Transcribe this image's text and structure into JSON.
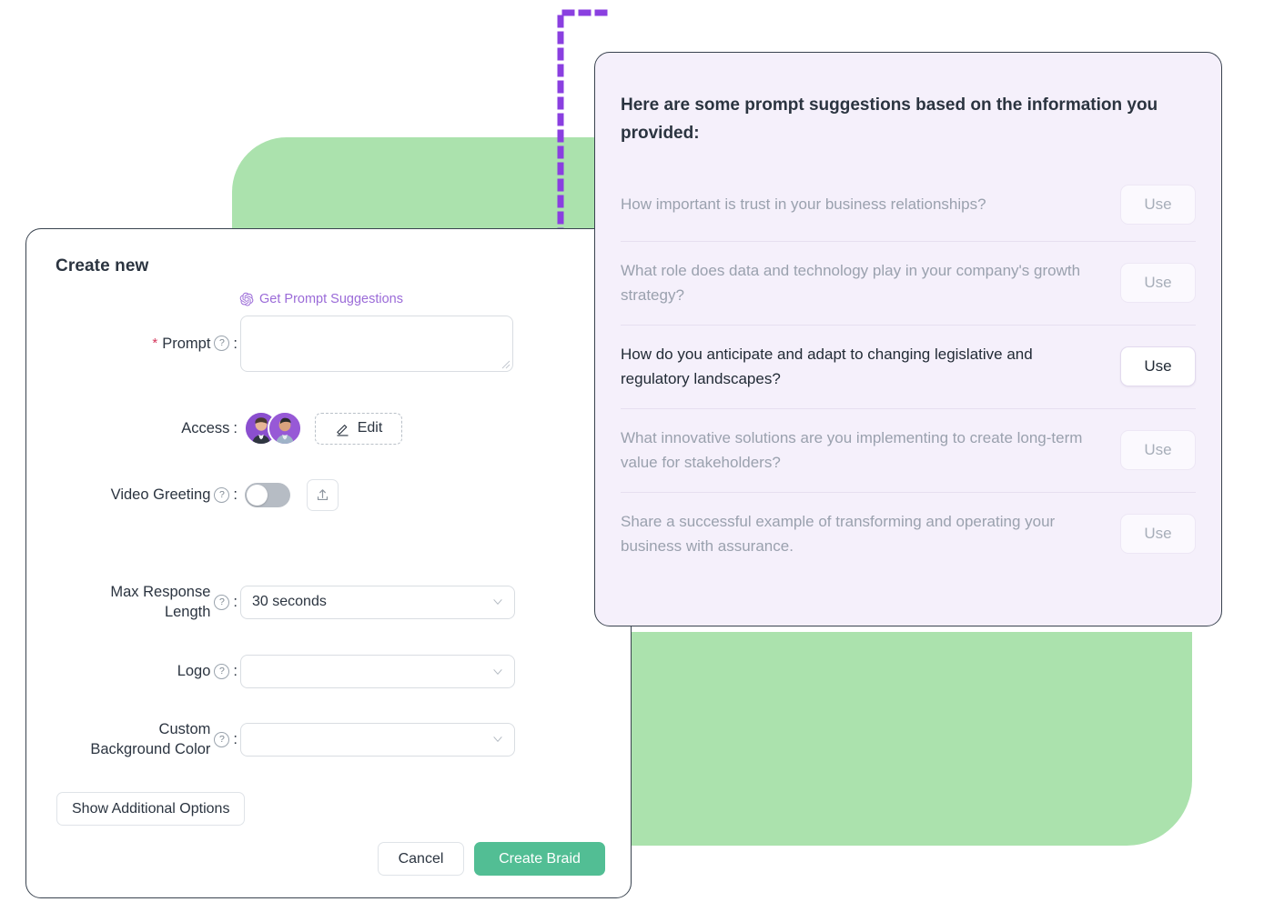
{
  "colors": {
    "green_blob": "#ABE2AD",
    "panel_background": "#F5F0FB",
    "accent_purple": "#9B6BD8",
    "connector_purple": "#8A3FE0",
    "primary_green_button": "#52BE94",
    "required_red": "#d4365b",
    "card_border": "#39434f"
  },
  "create_card": {
    "title": "Create new",
    "suggest_link": {
      "label": "Get Prompt Suggestions",
      "icon": "openai-knot-icon"
    },
    "fields": {
      "prompt": {
        "label": "Prompt",
        "required_marker": "*",
        "colon": ":",
        "help_icon": "question-circle-icon",
        "value": "",
        "placeholder": ""
      },
      "access": {
        "label": "Access",
        "colon": ":",
        "avatar_count": 2,
        "edit_label": "Edit",
        "edit_icon": "pencil-icon"
      },
      "video_greeting": {
        "label": "Video Greeting",
        "colon": ":",
        "help_icon": "question-circle-icon",
        "toggle_state": "off",
        "upload_icon": "upload-tray-icon"
      },
      "max_response_length": {
        "label": "Max Response\nLength",
        "colon": ":",
        "help_icon": "question-circle-icon",
        "value": "30 seconds",
        "chevron_icon": "chevron-down-icon"
      },
      "logo": {
        "label": "Logo",
        "colon": ":",
        "help_icon": "question-circle-icon",
        "value": "",
        "chevron_icon": "chevron-down-icon"
      },
      "custom_background_color": {
        "label": "Custom\nBackground Color",
        "colon": ":",
        "help_icon": "question-circle-icon",
        "value": "",
        "chevron_icon": "chevron-down-icon"
      }
    },
    "buttons": {
      "show_additional_options": "Show Additional Options",
      "cancel": "Cancel",
      "create": "Create Braid"
    }
  },
  "suggestions_panel": {
    "title": "Here are some prompt suggestions based on the information you provided:",
    "use_label": "Use",
    "items": [
      {
        "text": "How important is trust in your business relationships?",
        "active": false,
        "use_label": "Use"
      },
      {
        "text": "What role does data and technology play in your company's growth strategy?",
        "active": false,
        "use_label": "Use"
      },
      {
        "text": "How do you anticipate and adapt to changing legislative and regulatory landscapes?",
        "active": true,
        "use_label": "Use"
      },
      {
        "text": "What innovative solutions are you implementing to create long-term value for stakeholders?",
        "active": false,
        "use_label": "Use"
      },
      {
        "text": "Share a successful example of transforming and operating your business with assurance.",
        "active": false,
        "use_label": "Use"
      }
    ]
  }
}
